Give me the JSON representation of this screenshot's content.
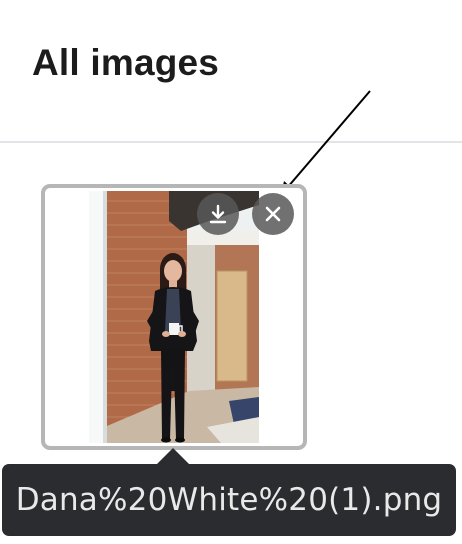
{
  "page": {
    "title": "All images"
  },
  "image_card": {
    "file_name": "Dana%20White%20(1).png",
    "actions": {
      "download_icon": "download-icon",
      "close_icon": "close-icon"
    }
  },
  "colors": {
    "card_border": "#b6b6b6",
    "action_button_bg": "#585858",
    "tooltip_bg": "#2b2c2f",
    "tooltip_text": "#e9e9e9"
  }
}
